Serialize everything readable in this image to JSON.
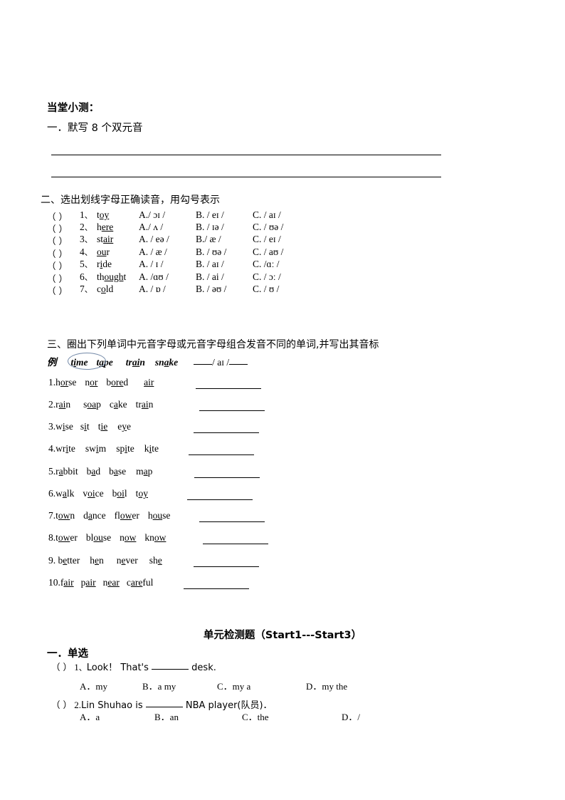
{
  "quiz": {
    "title": "当堂小测：",
    "section1": {
      "heading_prefix": "一．默写 ",
      "heading_num": "8",
      "heading_suffix": " 个双元音",
      "blank_lines": 2
    },
    "section2": {
      "heading": "二、选出划线字母正确读音，用勾号表示",
      "items": [
        {
          "paren": "（    ）",
          "num": "1",
          "sep": "、",
          "word_pre": "t",
          "word_mid": "oy",
          "word_post": "",
          "underline": "mid",
          "a": "A./ ɔɪ /",
          "b": "B. / eɪ /",
          "c": "C. / aɪ /"
        },
        {
          "paren": "（    ）",
          "num": "2",
          "sep": "、",
          "word_pre": "h",
          "word_mid": "ere",
          "word_post": "",
          "underline": "mid",
          "a": "A./ ʌ /",
          "b": "B. / ɪə /",
          "c": "C. / ʊə /"
        },
        {
          "paren": "（    ）",
          "num": "3",
          "sep": "、",
          "word_pre": "st",
          "word_mid": "air",
          "word_post": "",
          "underline": "mid",
          "a": "A. / eə /",
          "b": "B./ æ /",
          "c": "C. / eɪ /"
        },
        {
          "paren": "（    ）",
          "num": "4",
          "sep": "、",
          "word_pre": "",
          "word_mid": "ou",
          "word_post": "r",
          "underline": "mid",
          "a": "A. / æ /",
          "b": "B. / ʊə /",
          "c": "C. / aʊ /"
        },
        {
          "paren": "（    ）",
          "num": "5",
          "sep": "、",
          "word_pre": "r",
          "word_mid": "i",
          "word_post": "de",
          "underline": "mid",
          "a": "A. / ɪ /",
          "b": "B. / aɪ /",
          "c": "C. /ɑː /"
        },
        {
          "paren": "（    ）",
          "num": "6",
          "sep": "、",
          "word_pre": "th",
          "word_mid": "ough",
          "word_post": "t",
          "underline": "mid",
          "a": "A. /ɑʊ /",
          "b": "B. / ai /",
          "c": "C. / ɔː /"
        },
        {
          "paren": "（    ）",
          "num": "7",
          "sep": "、",
          "word_pre": "c",
          "word_mid": "o",
          "word_post": "ld",
          "underline": "mid",
          "a": "A. / ɒ /",
          "b": "B. / əʊ /",
          "c": "C. / ʊ /"
        }
      ]
    },
    "section3": {
      "heading": "三、圈出下列单词中元音字母或元音字母组合发音不同的单词,并写出其音标",
      "example": {
        "label": "例",
        "words": [
          {
            "pre": "t",
            "mid": "i",
            "post": "me"
          },
          {
            "pre": "t",
            "mid": "a",
            "post": "pe"
          },
          {
            "pre": "tr",
            "mid": "ai",
            "post": "n"
          },
          {
            "pre": "sn",
            "mid": "a",
            "post": "ke"
          }
        ],
        "answer": "/ aɪ /",
        "circled_word": "time",
        "circle_color": "#7389a8"
      },
      "rows": [
        {
          "num": "1.",
          "words": [
            {
              "pre": "h",
              "mid": "or",
              "post": "se"
            },
            {
              "pre": "n",
              "mid": "or",
              "post": ""
            },
            {
              "pre": "b",
              "mid": "ore",
              "post": "d"
            },
            {
              "pre": "",
              "mid": "air",
              "post": ""
            }
          ]
        },
        {
          "num": "2.",
          "words": [
            {
              "pre": "r",
              "mid": "ai",
              "post": "n"
            },
            {
              "pre": "s",
              "mid": "oa",
              "post": "p"
            },
            {
              "pre": "c",
              "mid": "a",
              "post": "ke"
            },
            {
              "pre": "tr",
              "mid": "ai",
              "post": "n"
            }
          ]
        },
        {
          "num": "3.",
          "words": [
            {
              "pre": "w",
              "mid": "i",
              "post": "se"
            },
            {
              "pre": "s",
              "mid": "i",
              "post": "t"
            },
            {
              "pre": "t",
              "mid": "ie",
              "post": ""
            },
            {
              "pre": "e",
              "mid": "y",
              "post": "e"
            }
          ]
        },
        {
          "num": "4.",
          "words": [
            {
              "pre": "wr",
              "mid": "i",
              "post": "te"
            },
            {
              "pre": "sw",
              "mid": "i",
              "post": "m"
            },
            {
              "pre": "sp",
              "mid": "i",
              "post": "te"
            },
            {
              "pre": "k",
              "mid": "i",
              "post": "te"
            }
          ]
        },
        {
          "num": "5.",
          "words": [
            {
              "pre": "r",
              "mid": "a",
              "post": "bbit"
            },
            {
              "pre": "b",
              "mid": "a",
              "post": "d"
            },
            {
              "pre": "b",
              "mid": "a",
              "post": "se"
            },
            {
              "pre": "m",
              "mid": "a",
              "post": "p"
            }
          ]
        },
        {
          "num": "6.",
          "words": [
            {
              "pre": "w",
              "mid": "a",
              "post": "lk"
            },
            {
              "pre": "v",
              "mid": "oi",
              "post": "ce"
            },
            {
              "pre": "b",
              "mid": "oi",
              "post": "l"
            },
            {
              "pre": "t",
              "mid": "oy",
              "post": ""
            }
          ]
        },
        {
          "num": "7.",
          "words": [
            {
              "pre": "t",
              "mid": "ow",
              "post": "n"
            },
            {
              "pre": "d",
              "mid": "a",
              "post": "nce"
            },
            {
              "pre": "fl",
              "mid": "ow",
              "post": "er"
            },
            {
              "pre": "h",
              "mid": "ou",
              "post": "se"
            }
          ]
        },
        {
          "num": "8.",
          "words": [
            {
              "pre": "t",
              "mid": "ow",
              "post": "er"
            },
            {
              "pre": "bl",
              "mid": "ou",
              "post": "se"
            },
            {
              "pre": "n",
              "mid": "ow",
              "post": ""
            },
            {
              "pre": "kn",
              "mid": "ow",
              "post": ""
            }
          ]
        },
        {
          "num": "9. ",
          "words": [
            {
              "pre": "b",
              "mid": "e",
              "post": "tter"
            },
            {
              "pre": "h",
              "mid": "e",
              "post": "n"
            },
            {
              "pre": "n",
              "mid": "e",
              "post": "ver"
            },
            {
              "pre": "sh",
              "mid": "e",
              "post": ""
            }
          ]
        },
        {
          "num": "10.",
          "words": [
            {
              "pre": "f",
              "mid": "air",
              "post": ""
            },
            {
              "pre": "p",
              "mid": "air",
              "post": ""
            },
            {
              "pre": "n",
              "mid": "ear",
              "post": ""
            },
            {
              "pre": "c",
              "mid": "are",
              "post": "ful"
            }
          ]
        }
      ]
    }
  },
  "unit_test": {
    "title_cn": "单元检测题",
    "title_range": "（Start1---Start3）",
    "section1_heading": "一．单选",
    "questions": [
      {
        "paren": "（   ）",
        "num": "1",
        "sep": "、",
        "text_before": "Look！ That's ",
        "text_after": " desk.",
        "options": [
          {
            "label": "A．",
            "text": "my"
          },
          {
            "label": "B．",
            "text": "a my"
          },
          {
            "label": "C．",
            "text": "my a"
          },
          {
            "label": "D．",
            "text": "my the"
          }
        ]
      },
      {
        "paren": "（   ）",
        "num": "2.",
        "sep": "",
        "text_before": "Lin Shuhao is ",
        "text_after": " NBA player(队员)．",
        "options": [
          {
            "label": "A．",
            "text": "a"
          },
          {
            "label": "B．",
            "text": "an"
          },
          {
            "label": "C．",
            "text": "the"
          },
          {
            "label": "D．",
            "text": "/"
          }
        ]
      }
    ]
  }
}
